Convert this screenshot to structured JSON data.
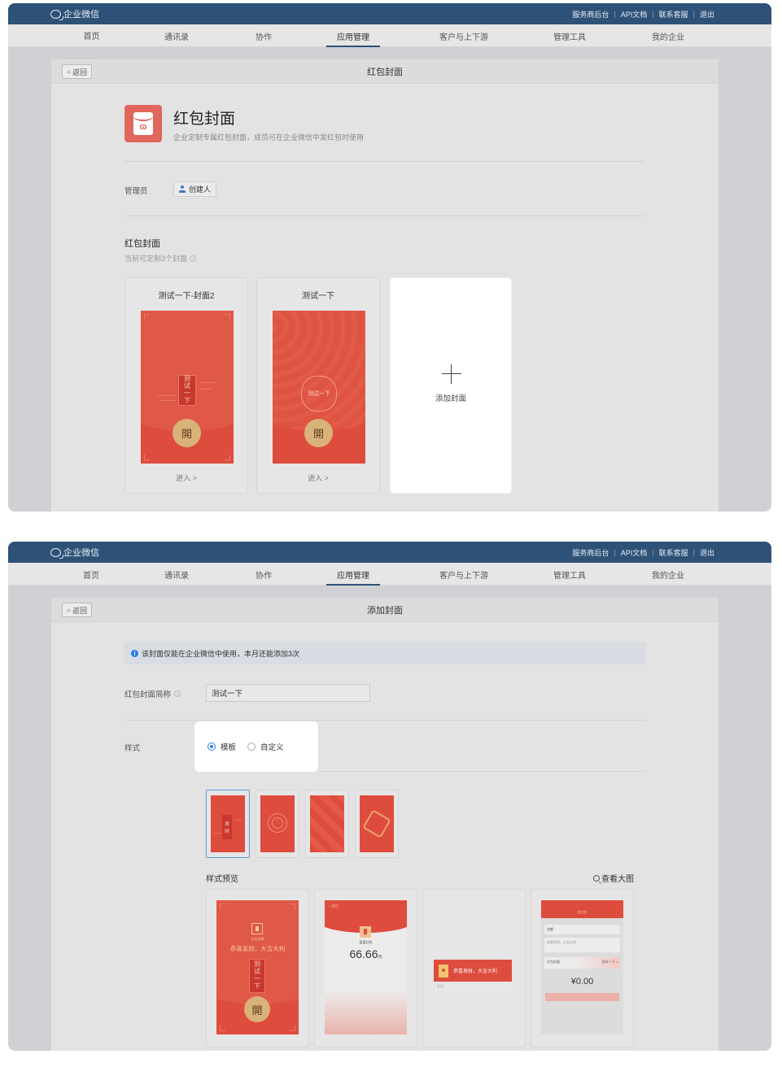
{
  "app": {
    "logo_text": "企业微信",
    "top_links": [
      "服务商后台",
      "API文档",
      "联系客服",
      "退出"
    ],
    "nav": [
      {
        "label": "首页",
        "active": false
      },
      {
        "label": "通讯录",
        "active": false
      },
      {
        "label": "协作",
        "active": false
      },
      {
        "label": "应用管理",
        "active": true
      },
      {
        "label": "客户与上下游",
        "active": false
      },
      {
        "label": "管理工具",
        "active": false
      },
      {
        "label": "我的企业",
        "active": false
      }
    ],
    "back_label": "返回"
  },
  "screen1": {
    "panel_title": "红包封面",
    "app_name": "红包封面",
    "app_desc": "企业定制专属红包封面，成员可在企业微信中发红包时使用",
    "admin_label": "管理员",
    "admin_value": "创建人",
    "section_title": "红包封面",
    "section_sub": "当前可定制3个封面",
    "covers": [
      {
        "name": "测试一下-封面2",
        "inner_text": [
          "测",
          "试",
          "一",
          "下"
        ],
        "open_glyph": "開",
        "enter_label": "进入 >"
      },
      {
        "name": "测试一下",
        "inner_text": "测试一下",
        "open_glyph": "開",
        "enter_label": "进入 >"
      }
    ],
    "add_label": "添加封面"
  },
  "screen2": {
    "panel_title": "添加封面",
    "notice": "该封面仅能在企业微信中使用，本月还能添加3次",
    "name_label": "红包封面简称",
    "name_value": "测试一下",
    "style_label": "样式",
    "radio_options": [
      {
        "label": "模板",
        "checked": true
      },
      {
        "label": "自定义",
        "checked": false
      }
    ],
    "templates": [
      {
        "id": "tpl-1",
        "text": [
          "发",
          "财"
        ],
        "selected": true
      },
      {
        "id": "tpl-2",
        "selected": false
      },
      {
        "id": "tpl-3",
        "selected": false
      },
      {
        "id": "tpl-4",
        "selected": false
      }
    ],
    "preview_label": "样式预览",
    "zoom_label": "查看大图",
    "previews": {
      "p1": {
        "sender": "企业名称",
        "greeting": "恭喜发财，大吉大利",
        "title": [
          "测",
          "试",
          "一",
          "下"
        ],
        "open_glyph": "開"
      },
      "p2": {
        "back": "< 返回",
        "sender": "某某红包",
        "amount": "66.66",
        "unit": "元"
      },
      "p3": {
        "bubble_text": "恭喜发财，大吉大利",
        "footer": "红包"
      },
      "p4": {
        "title": "发红包",
        "row1": "金额",
        "row2": "恭喜发财，大吉大利",
        "row3_left": "红包封面",
        "row3_right": "测试一下 >",
        "money": "¥0.00"
      }
    }
  }
}
